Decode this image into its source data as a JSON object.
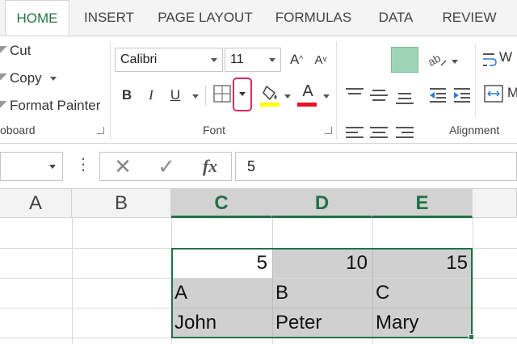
{
  "tabs": [
    "HOME",
    "INSERT",
    "PAGE LAYOUT",
    "FORMULAS",
    "DATA",
    "REVIEW"
  ],
  "clipboard": {
    "cut": "Cut",
    "copy": "Copy",
    "format_painter": "Format Painter",
    "label": "oboard"
  },
  "font": {
    "name": "Calibri",
    "size": "11",
    "grow": "A",
    "shrink": "A",
    "bold": "B",
    "italic": "I",
    "underline": "U",
    "font_color_letter": "A",
    "label": "Font",
    "highlight_color": "#ffff00",
    "font_color": "#e81123"
  },
  "alignment": {
    "label": "Alignment",
    "wrap_prefix": "W"
  },
  "formula_bar": {
    "fx": "fx",
    "value": "5"
  },
  "columns": [
    "A",
    "B",
    "C",
    "D",
    "E"
  ],
  "cells": {
    "row1": [
      "5",
      "10",
      "15"
    ],
    "row2": [
      "A",
      "B",
      "C"
    ],
    "row3": [
      "John",
      "Peter",
      "Mary"
    ]
  },
  "colors": {
    "accent": "#217346",
    "selection_fill": "#d0d0d0",
    "highlight_outline": "#e0285a"
  }
}
